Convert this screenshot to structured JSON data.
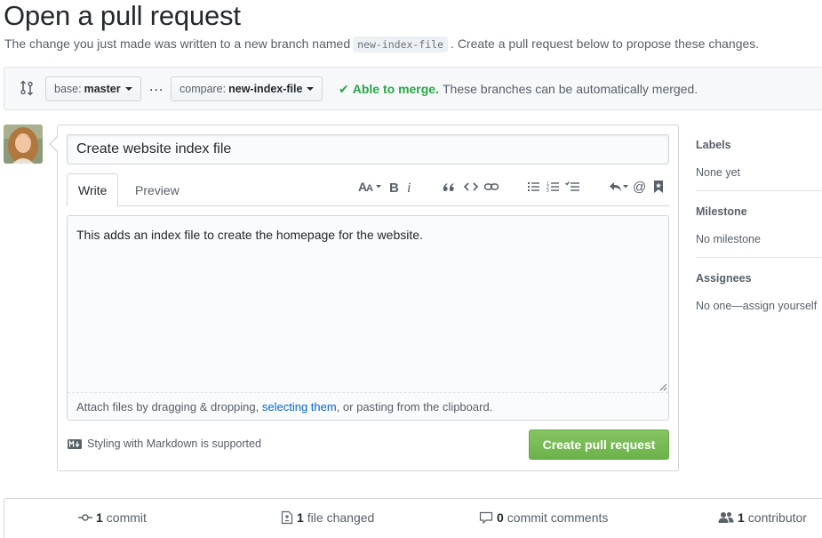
{
  "page": {
    "title": "Open a pull request",
    "intro_before": "The change you just made was written to a new branch named",
    "branch_name": "new-index-file",
    "intro_after": ". Create a pull request below to propose these changes."
  },
  "range": {
    "base_prefix": "base:",
    "base_branch": "master",
    "ellipsis": "...",
    "compare_prefix": "compare:",
    "compare_branch": "new-index-file",
    "merge_status": "Able to merge.",
    "merge_detail": "These branches can be automatically merged.",
    "merge_color": "#28a745"
  },
  "form": {
    "title_value": "Create website index file",
    "tab_write": "Write",
    "tab_preview": "Preview",
    "toolbar": [
      "header-icon",
      "bold-icon",
      "italic-icon",
      "quote-icon",
      "code-icon",
      "link-icon",
      "unordered-list-icon",
      "ordered-list-icon",
      "task-list-icon",
      "reply-icon",
      "mention-icon",
      "bookmark-icon"
    ],
    "body_value": "This adds an index file to create the homepage for the website.",
    "attach_before": "Attach files by dragging & dropping,",
    "attach_link": "selecting them",
    "attach_after": ", or pasting from the clipboard.",
    "markdown_note": "Styling with Markdown is supported",
    "submit_label": "Create pull request",
    "submit_color": "#6cb24a"
  },
  "sidebar": {
    "labels_heading": "Labels",
    "labels_value": "None yet",
    "milestone_heading": "Milestone",
    "milestone_value": "No milestone",
    "assignees_heading": "Assignees",
    "assignees_value": "No one—assign yourself"
  },
  "summary": {
    "commits_count": "1",
    "commits_label": "commit",
    "files_count": "1",
    "files_label": "file changed",
    "comments_count": "0",
    "comments_label": "commit comments",
    "contributors_count": "1",
    "contributors_label": "contributor"
  }
}
